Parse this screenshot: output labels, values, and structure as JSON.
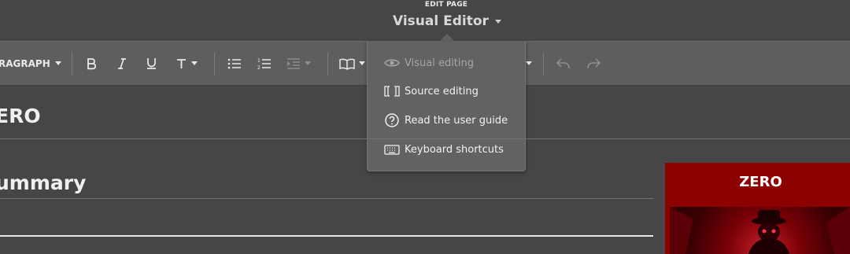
{
  "header": {
    "edit_label": "EDIT PAGE",
    "mode_title": "Visual Editor"
  },
  "toolbar": {
    "paragraph_label": "RAGRAPH",
    "buttons": [
      "bold-icon",
      "italic-icon",
      "underline-icon",
      "text-style-icon",
      "bullet-list-icon",
      "numbered-list-icon",
      "indent-icon",
      "cite-icon",
      "undo-icon",
      "redo-icon"
    ]
  },
  "dropdown": {
    "items": [
      {
        "label": "Visual editing",
        "icon": "eye-icon",
        "disabled": true
      },
      {
        "label": "Source editing",
        "icon": "source-brackets-icon",
        "disabled": false
      },
      {
        "label": "Read the user guide",
        "icon": "help-icon",
        "disabled": false
      },
      {
        "label": "Keyboard shortcuts",
        "icon": "keyboard-icon",
        "disabled": false
      }
    ]
  },
  "content": {
    "heading1": "ERO",
    "heading2": "ummary"
  },
  "infobox": {
    "title": "ZERO",
    "accent_color": "#8c0000"
  }
}
